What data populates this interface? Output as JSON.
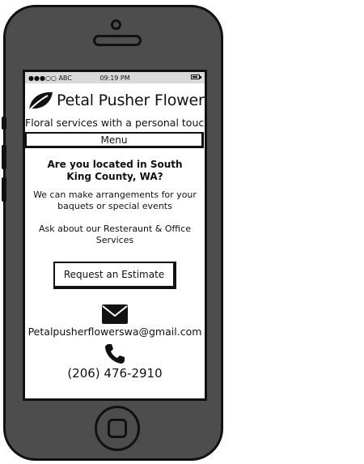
{
  "status_bar": {
    "carrier": "●●●○○ ABC",
    "time": "09:19 PM"
  },
  "brand": {
    "name": "Petal Pusher Flowers",
    "logo_icon": "leaf-icon"
  },
  "tagline": "Floral services with a personal touch",
  "menu": {
    "label": "Menu"
  },
  "content": {
    "headline": "Are you located in South King County, WA?",
    "paragraph_1": "We can make arrangements for your baquets or special events",
    "paragraph_2": "Ask about our Resteraunt & Office Services"
  },
  "estimate_button": {
    "label": "Request an Estimate"
  },
  "contact": {
    "email_icon": "envelope-icon",
    "email": "Petalpusherflowerswa@gmail.com",
    "phone_icon": "phone-icon",
    "phone": "(206) 476-2910"
  },
  "colors": {
    "device_body": "#4d4d4d",
    "outline": "#111111",
    "status_bar_bg": "#d9d9d9",
    "screen_bg": "#ffffff"
  }
}
